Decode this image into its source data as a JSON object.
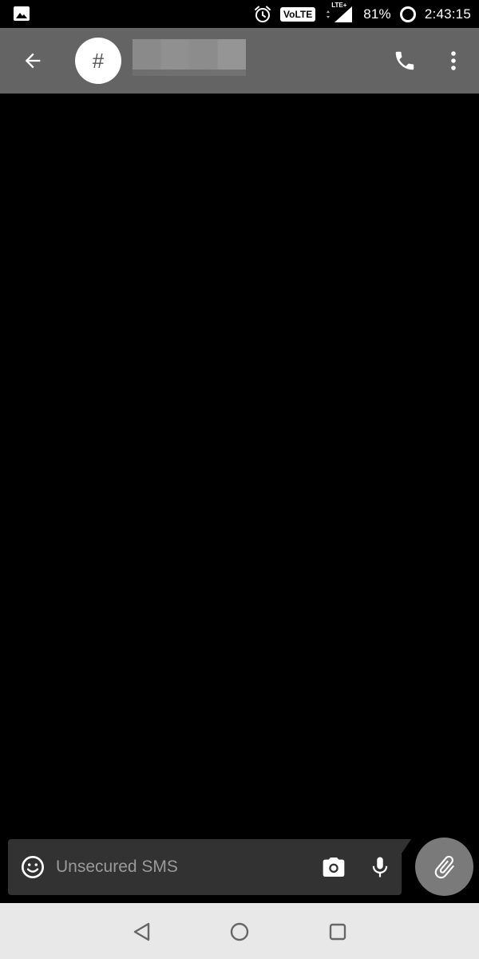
{
  "status_bar": {
    "left_icon": "image-icon",
    "icons": [
      "alarm-icon",
      "volte-icon",
      "lte-icon",
      "signal-icon",
      "battery-icon"
    ],
    "volte_label": "VoLTE",
    "lte_label": "LTE+",
    "battery_level": "81%",
    "time": "2:43:15"
  },
  "app_bar": {
    "back_icon": "arrow-back-icon",
    "avatar_symbol": "#",
    "contact_name": "",
    "call_icon": "phone-icon",
    "overflow_icon": "more-vert-icon",
    "background_color": "#646464"
  },
  "compose": {
    "emoji_icon": "emoji-icon",
    "placeholder": "Unsecured SMS",
    "value": "",
    "camera_icon": "camera-icon",
    "mic_icon": "mic-icon",
    "attach_icon": "paperclip-icon",
    "background_color": "#323232",
    "attach_color": "#7a7a7a"
  },
  "nav_bar": {
    "buttons": [
      "nav-back-icon",
      "nav-home-icon",
      "nav-recents-icon"
    ],
    "background_color": "#e8e8e8"
  }
}
